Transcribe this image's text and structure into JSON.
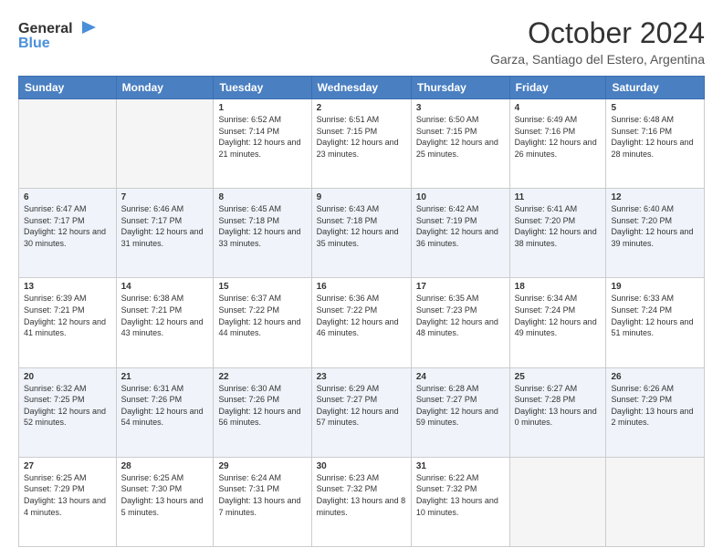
{
  "header": {
    "logo_line1": "General",
    "logo_line2": "Blue",
    "month": "October 2024",
    "subtitle": "Garza, Santiago del Estero, Argentina"
  },
  "days_of_week": [
    "Sunday",
    "Monday",
    "Tuesday",
    "Wednesday",
    "Thursday",
    "Friday",
    "Saturday"
  ],
  "weeks": [
    [
      {
        "day": "",
        "info": ""
      },
      {
        "day": "",
        "info": ""
      },
      {
        "day": "1",
        "info": "Sunrise: 6:52 AM\nSunset: 7:14 PM\nDaylight: 12 hours and 21 minutes."
      },
      {
        "day": "2",
        "info": "Sunrise: 6:51 AM\nSunset: 7:15 PM\nDaylight: 12 hours and 23 minutes."
      },
      {
        "day": "3",
        "info": "Sunrise: 6:50 AM\nSunset: 7:15 PM\nDaylight: 12 hours and 25 minutes."
      },
      {
        "day": "4",
        "info": "Sunrise: 6:49 AM\nSunset: 7:16 PM\nDaylight: 12 hours and 26 minutes."
      },
      {
        "day": "5",
        "info": "Sunrise: 6:48 AM\nSunset: 7:16 PM\nDaylight: 12 hours and 28 minutes."
      }
    ],
    [
      {
        "day": "6",
        "info": "Sunrise: 6:47 AM\nSunset: 7:17 PM\nDaylight: 12 hours and 30 minutes."
      },
      {
        "day": "7",
        "info": "Sunrise: 6:46 AM\nSunset: 7:17 PM\nDaylight: 12 hours and 31 minutes."
      },
      {
        "day": "8",
        "info": "Sunrise: 6:45 AM\nSunset: 7:18 PM\nDaylight: 12 hours and 33 minutes."
      },
      {
        "day": "9",
        "info": "Sunrise: 6:43 AM\nSunset: 7:18 PM\nDaylight: 12 hours and 35 minutes."
      },
      {
        "day": "10",
        "info": "Sunrise: 6:42 AM\nSunset: 7:19 PM\nDaylight: 12 hours and 36 minutes."
      },
      {
        "day": "11",
        "info": "Sunrise: 6:41 AM\nSunset: 7:20 PM\nDaylight: 12 hours and 38 minutes."
      },
      {
        "day": "12",
        "info": "Sunrise: 6:40 AM\nSunset: 7:20 PM\nDaylight: 12 hours and 39 minutes."
      }
    ],
    [
      {
        "day": "13",
        "info": "Sunrise: 6:39 AM\nSunset: 7:21 PM\nDaylight: 12 hours and 41 minutes."
      },
      {
        "day": "14",
        "info": "Sunrise: 6:38 AM\nSunset: 7:21 PM\nDaylight: 12 hours and 43 minutes."
      },
      {
        "day": "15",
        "info": "Sunrise: 6:37 AM\nSunset: 7:22 PM\nDaylight: 12 hours and 44 minutes."
      },
      {
        "day": "16",
        "info": "Sunrise: 6:36 AM\nSunset: 7:22 PM\nDaylight: 12 hours and 46 minutes."
      },
      {
        "day": "17",
        "info": "Sunrise: 6:35 AM\nSunset: 7:23 PM\nDaylight: 12 hours and 48 minutes."
      },
      {
        "day": "18",
        "info": "Sunrise: 6:34 AM\nSunset: 7:24 PM\nDaylight: 12 hours and 49 minutes."
      },
      {
        "day": "19",
        "info": "Sunrise: 6:33 AM\nSunset: 7:24 PM\nDaylight: 12 hours and 51 minutes."
      }
    ],
    [
      {
        "day": "20",
        "info": "Sunrise: 6:32 AM\nSunset: 7:25 PM\nDaylight: 12 hours and 52 minutes."
      },
      {
        "day": "21",
        "info": "Sunrise: 6:31 AM\nSunset: 7:26 PM\nDaylight: 12 hours and 54 minutes."
      },
      {
        "day": "22",
        "info": "Sunrise: 6:30 AM\nSunset: 7:26 PM\nDaylight: 12 hours and 56 minutes."
      },
      {
        "day": "23",
        "info": "Sunrise: 6:29 AM\nSunset: 7:27 PM\nDaylight: 12 hours and 57 minutes."
      },
      {
        "day": "24",
        "info": "Sunrise: 6:28 AM\nSunset: 7:27 PM\nDaylight: 12 hours and 59 minutes."
      },
      {
        "day": "25",
        "info": "Sunrise: 6:27 AM\nSunset: 7:28 PM\nDaylight: 13 hours and 0 minutes."
      },
      {
        "day": "26",
        "info": "Sunrise: 6:26 AM\nSunset: 7:29 PM\nDaylight: 13 hours and 2 minutes."
      }
    ],
    [
      {
        "day": "27",
        "info": "Sunrise: 6:25 AM\nSunset: 7:29 PM\nDaylight: 13 hours and 4 minutes."
      },
      {
        "day": "28",
        "info": "Sunrise: 6:25 AM\nSunset: 7:30 PM\nDaylight: 13 hours and 5 minutes."
      },
      {
        "day": "29",
        "info": "Sunrise: 6:24 AM\nSunset: 7:31 PM\nDaylight: 13 hours and 7 minutes."
      },
      {
        "day": "30",
        "info": "Sunrise: 6:23 AM\nSunset: 7:32 PM\nDaylight: 13 hours and 8 minutes."
      },
      {
        "day": "31",
        "info": "Sunrise: 6:22 AM\nSunset: 7:32 PM\nDaylight: 13 hours and 10 minutes."
      },
      {
        "day": "",
        "info": ""
      },
      {
        "day": "",
        "info": ""
      }
    ]
  ]
}
